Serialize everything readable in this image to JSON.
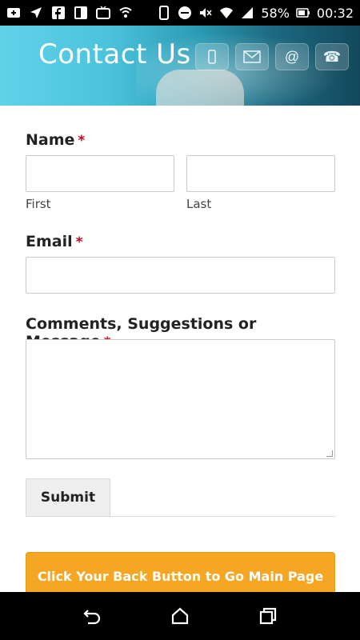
{
  "status_bar": {
    "battery": "58%",
    "time": "00:32",
    "icons": [
      "add-icon",
      "navigation-icon",
      "facebook-icon",
      "screen-icon",
      "tv-icon",
      "shield-icon",
      "phone-icon",
      "minus-circle-icon",
      "mute-icon",
      "wifi-icon",
      "signal-icon",
      "battery-icon"
    ]
  },
  "header": {
    "title": "Contact Us",
    "icons": [
      "mobile-icon",
      "mail-icon",
      "at-icon",
      "telephone-icon"
    ],
    "at_symbol": "@",
    "phone_symbol": "☎"
  },
  "form": {
    "name": {
      "label": "Name",
      "required": "*",
      "first_sublabel": "First",
      "last_sublabel": "Last",
      "first_value": "",
      "last_value": ""
    },
    "email": {
      "label": "Email",
      "required": "*",
      "value": ""
    },
    "message": {
      "label": "Comments, Suggestions or Message",
      "required": "*",
      "value": ""
    },
    "submit_label": "Submit"
  },
  "back_button": {
    "label": "Click Your Back Button to Go Main Page"
  },
  "nav_bar": {
    "buttons": [
      "back-icon",
      "home-icon",
      "recents-icon"
    ]
  },
  "colors": {
    "accent": "#f5a623",
    "required": "#d0021b",
    "banner": "#4cc3dd"
  }
}
